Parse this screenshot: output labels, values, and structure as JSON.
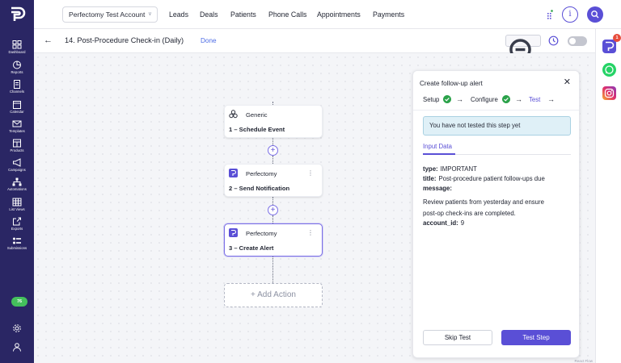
{
  "colors": {
    "sidebar": "#2a2664",
    "accent": "#5a4fd6",
    "success": "#2ba24a",
    "notice_bg": "#dff0f7"
  },
  "sidebar": {
    "items": [
      {
        "label": "Dashboard",
        "icon": "grid-icon"
      },
      {
        "label": "Reports",
        "icon": "pie-chart-icon"
      },
      {
        "label": "Channels",
        "icon": "document-icon"
      },
      {
        "label": "Calendar",
        "icon": "calendar-icon"
      },
      {
        "label": "Templates",
        "icon": "mail-icon"
      },
      {
        "label": "Products",
        "icon": "store-icon"
      },
      {
        "label": "Campaigns",
        "icon": "megaphone-icon"
      },
      {
        "label": "Automations",
        "icon": "sitemap-icon"
      },
      {
        "label": "List Views",
        "icon": "table-icon"
      },
      {
        "label": "Exports",
        "icon": "export-icon"
      },
      {
        "label": "Submissions",
        "icon": "list-toggle-icon"
      }
    ],
    "notification_badge": "76"
  },
  "header": {
    "account": "Perfectomy Test Account",
    "nav": [
      "Leads",
      "Deals",
      "Patients",
      "Phone Calls",
      "Appointments",
      "Payments"
    ]
  },
  "subheader": {
    "flow_title": "14. Post-Procedure Check-in (Daily)",
    "done_label": "Done"
  },
  "rail": {
    "badge": "1"
  },
  "flow": {
    "nodes": [
      {
        "app": "Generic",
        "step": "1 – Schedule Event"
      },
      {
        "app": "Perfectomy",
        "step": "2 – Send Notification"
      },
      {
        "app": "Perfectomy",
        "step": "3 – Create Alert"
      }
    ],
    "add_action": "Add Action",
    "watermark": "React Flow"
  },
  "panel": {
    "title": "Create follow-up alert",
    "steps": [
      "Setup",
      "Configure",
      "Test"
    ],
    "notice": "You have not tested this step yet",
    "tab": "Input Data",
    "fields": {
      "type_key": "type:",
      "type_val": "IMPORTANT",
      "title_key": "title:",
      "title_val": "Post-procedure patient follow-ups due",
      "message_key": "message:",
      "message_line1": "Review patients from yesterday and ensure",
      "message_line2": "post-op check-ins are completed.",
      "account_key": "account_id:",
      "account_val": "9"
    },
    "skip_label": "Skip Test",
    "test_label": "Test Step"
  }
}
